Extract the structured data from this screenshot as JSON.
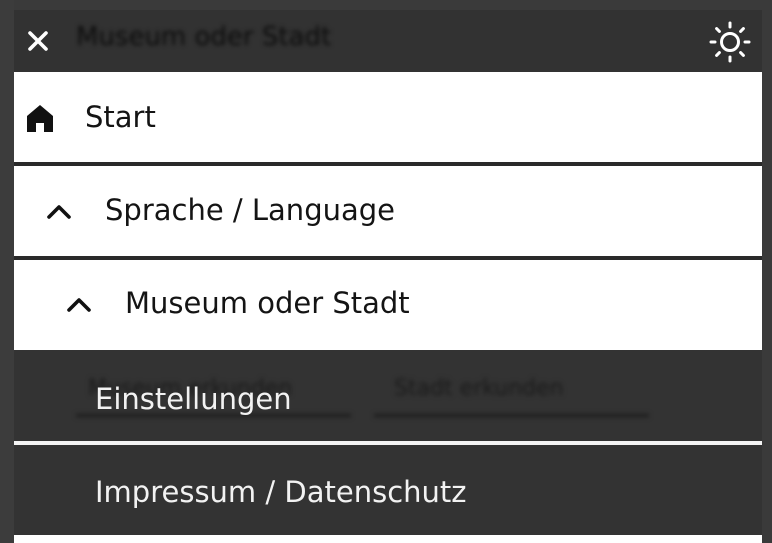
{
  "header": {
    "title_blurred": "Museum oder Stadt",
    "close_icon": "close-icon",
    "theme_icon": "sun-icon"
  },
  "menu": {
    "items": [
      {
        "label": "Start",
        "icon": "home-icon"
      },
      {
        "label": "Sprache / Language",
        "icon": "chevron-up-icon"
      },
      {
        "label": "Museum oder Stadt",
        "icon": "chevron-up-icon"
      },
      {
        "label": "Einstellungen",
        "icon": ""
      },
      {
        "label": "Impressum / Datenschutz",
        "icon": ""
      }
    ],
    "background_links": [
      "Museum erkunden",
      "Stadt erkunden"
    ]
  },
  "colors": {
    "dark": "#333333",
    "light": "#ffffff",
    "text_dark": "#141414",
    "text_light": "#f2f2f2"
  }
}
